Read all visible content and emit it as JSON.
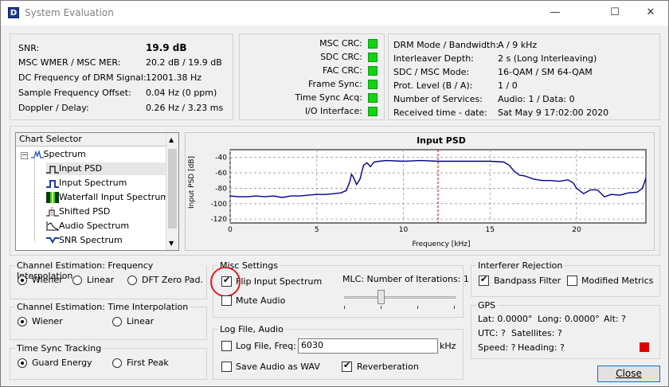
{
  "window": {
    "title": "System Evaluation",
    "icon_letter": "D"
  },
  "status": {
    "rows": [
      {
        "label": "SNR:",
        "value": "19.9 dB"
      },
      {
        "label": "MSC WMER / MSC MER:",
        "value": "20.2 dB / 19.9 dB"
      },
      {
        "label": "DC Frequency of DRM Signal:",
        "value": "12001.38 Hz"
      },
      {
        "label": "Sample Frequency Offset:",
        "value": "0.04 Hz (0 ppm)"
      },
      {
        "label": "Doppler / Delay:",
        "value": "0.26 Hz / 3.23 ms"
      }
    ]
  },
  "crc": {
    "items": [
      "MSC CRC:",
      "SDC CRC:",
      "FAC CRC:",
      "Frame Sync:",
      "Time Sync Acq:",
      "I/O Interface:"
    ],
    "led_color": "#14d214"
  },
  "drm": {
    "rows": [
      {
        "label": "DRM Mode / Bandwidth:",
        "value": "A / 9 kHz"
      },
      {
        "label": "Interleaver Depth:",
        "value": "2 s (Long Interleaving)"
      },
      {
        "label": "SDC / MSC Mode:",
        "value": "16-QAM / SM 64-QAM"
      },
      {
        "label": "Prot. Level (B / A):",
        "value": "1 / 0"
      },
      {
        "label": "Number of Services:",
        "value": "Audio: 1 / Data: 0"
      },
      {
        "label": "Received time - date:",
        "value": "Sat May 9 17:02:00 2020"
      }
    ]
  },
  "chart_selector": {
    "header": "Chart Selector",
    "root": "Spectrum",
    "root_expander": "−",
    "items": [
      "Input PSD",
      "Input Spectrum",
      "Waterfall Input Spectrum",
      "Shifted PSD",
      "Audio Spectrum",
      "SNR Spectrum"
    ],
    "icons": [
      "psd-icon",
      "spectrum-icon",
      "waterfall-icon",
      "shifted-psd-icon",
      "audio-spectrum-icon",
      "snr-spectrum-icon"
    ],
    "selected_index": 0
  },
  "chart_data": {
    "type": "line",
    "title": "Input PSD",
    "xlabel": "Frequency [kHz]",
    "ylabel": "Input PSD [dB]",
    "xlim": [
      0,
      24
    ],
    "ylim": [
      -125,
      -30
    ],
    "xticks": [
      0,
      5,
      10,
      15,
      20
    ],
    "yticks": [
      -40,
      -60,
      -80,
      -100,
      -120
    ],
    "line_color": "#00008b",
    "marker_x": 12,
    "marker_color": "#c00000",
    "series": [
      {
        "x": [
          0,
          0.5,
          1,
          1.5,
          2,
          2.5,
          3,
          3.5,
          4,
          4.5,
          5,
          5.5,
          6,
          6.4,
          6.7,
          6.9,
          7.0,
          7.1,
          7.3,
          7.5,
          7.7,
          7.9,
          8.1,
          8.3,
          8.6,
          9,
          10,
          11,
          12,
          13,
          14,
          15,
          15.8,
          16.1,
          16.4,
          16.7,
          17,
          17.5,
          18,
          18.5,
          19,
          19.5,
          19.8,
          20,
          20.4,
          20.8,
          21.2,
          21.6,
          22,
          22.5,
          23,
          23.5,
          23.8,
          24
        ],
        "y": [
          -90,
          -91,
          -91,
          -90,
          -91,
          -90,
          -92,
          -90,
          -90,
          -89,
          -88,
          -88,
          -87,
          -86,
          -83,
          -72,
          -62,
          -65,
          -75,
          -68,
          -50,
          -47,
          -52,
          -46,
          -45,
          -44,
          -45,
          -44,
          -45,
          -45,
          -45,
          -45,
          -46,
          -50,
          -58,
          -63,
          -64,
          -68,
          -70,
          -70,
          -71,
          -69,
          -73,
          -80,
          -87,
          -82,
          -82,
          -91,
          -88,
          -89,
          -86,
          -85,
          -80,
          -67
        ]
      }
    ]
  },
  "freq_interp": {
    "title": "Channel Estimation: Frequency Interpolation",
    "options": [
      "Wiener",
      "Linear",
      "DFT Zero Pad."
    ],
    "selected": 0
  },
  "time_interp": {
    "title": "Channel Estimation: Time Interpolation",
    "options": [
      "Wiener",
      "Linear"
    ],
    "selected": 0
  },
  "time_sync": {
    "title": "Time Sync Tracking",
    "options": [
      "Guard Energy",
      "First Peak"
    ],
    "selected": 0
  },
  "misc": {
    "title": "Misc Settings",
    "flip_label": "Flip Input Spectrum",
    "flip_checked": true,
    "mute_label": "Mute Audio",
    "mute_checked": false,
    "mlc_label": "MLC: Number of Iterations: 1",
    "mlc_fraction": 0.32
  },
  "logfile": {
    "title": "Log File, Audio",
    "log_label": "Log File, Freq:",
    "log_checked": false,
    "freq_value": "6030",
    "freq_unit": "kHz",
    "save_label": "Save Audio as WAV",
    "save_checked": false,
    "reverb_label": "Reverberation",
    "reverb_checked": true
  },
  "interferer": {
    "title": "Interferer Rejection",
    "bandpass_label": "Bandpass Filter",
    "bandpass_checked": true,
    "modified_label": "Modified Metrics",
    "modified_checked": false
  },
  "gps": {
    "title": "GPS",
    "lat": "Lat: 0.0000°",
    "long": "Long: 0.0000°",
    "alt": "Alt: ?",
    "utc": "UTC: ?",
    "satellites": "Satellites: ?",
    "speed": "Speed: ?",
    "heading": "Heading: ?",
    "indicator_color": "#e00000"
  },
  "close_button": "Close"
}
